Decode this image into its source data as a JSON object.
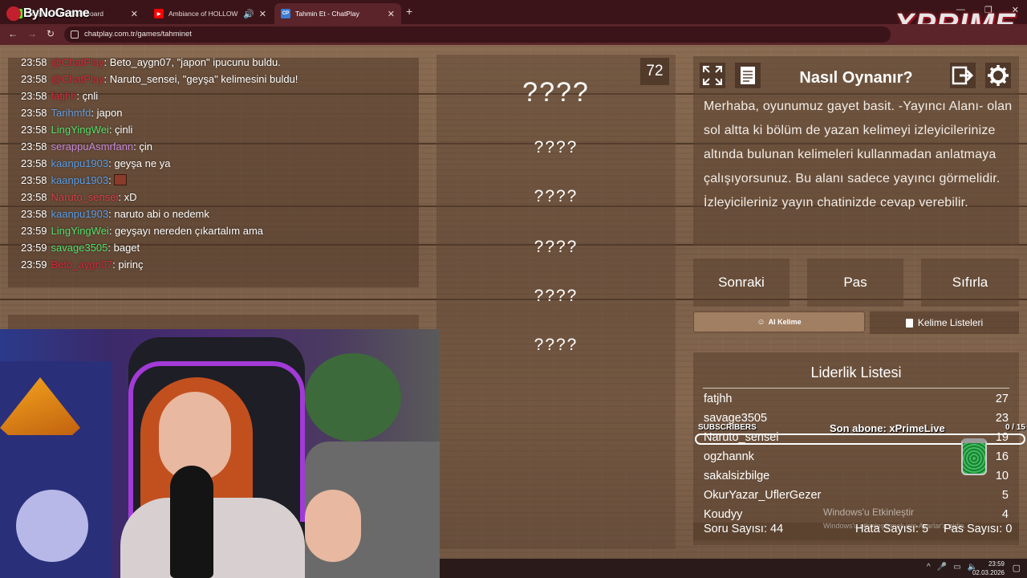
{
  "browser": {
    "tabs": [
      {
        "title": "Stream - Kick Dashboard",
        "icon": "kick-icon",
        "color": "#53fc18"
      },
      {
        "title": "Ambiance of HOLLOW KNIGHT",
        "icon": "youtube-icon",
        "color": "#ff0000"
      },
      {
        "title": "Tahmin Et - ChatPlay",
        "icon": "chatplay-icon",
        "color": "#3a7bd5"
      }
    ],
    "url": "chatplay.com.tr/games/tahminet"
  },
  "overlay": {
    "channel_logo": "ByNoGame",
    "brand": "XPRIME"
  },
  "chat": {
    "messages": [
      {
        "time": "23:58",
        "user": "@ChatPlay",
        "text": ": Beto_aygn07, \"japon\" ipucunu buldu.",
        "color": "#d42a3a"
      },
      {
        "time": "23:58",
        "user": "@ChatPlay",
        "text": ": Naruto_sensei, \"geyşa\" kelimesini buldu!",
        "color": "#d42a3a"
      },
      {
        "time": "23:58",
        "user": "fatjhh",
        "text": ": çnli",
        "color": "#d42a3a"
      },
      {
        "time": "23:58",
        "user": "Tarihmfd",
        "text": ": japon",
        "color": "#6a9edc"
      },
      {
        "time": "23:58",
        "user": "LingYingWei",
        "text": ": çinli",
        "color": "#55e06a"
      },
      {
        "time": "23:58",
        "user": "serappuAsmrfann",
        "text": ": çin",
        "color": "#c98ad8"
      },
      {
        "time": "23:58",
        "user": "kaanpu1903",
        "text": ": geyşa ne ya",
        "color": "#5a9ee8"
      },
      {
        "time": "23:58",
        "user": "kaanpu1903",
        "text": ": ",
        "color": "#5a9ee8",
        "emote": true
      },
      {
        "time": "23:58",
        "user": "Naruto_sensei",
        "text": ": xD",
        "color": "#d4404a"
      },
      {
        "time": "23:58",
        "user": "kaanpu1903",
        "text": ": naruto abi o nedemk",
        "color": "#5a9ee8"
      },
      {
        "time": "23:59",
        "user": "LingYingWei",
        "text": ": geyşayı nereden çıkartalım ama",
        "color": "#55e06a"
      },
      {
        "time": "23:59",
        "user": "savage3505",
        "text": ": baget",
        "color": "#55e06a"
      },
      {
        "time": "23:59",
        "user": "Beto_aygn07",
        "text": ": pirinç",
        "color": "#d42a3a"
      }
    ]
  },
  "game": {
    "timer": "72",
    "words": [
      "????",
      "????",
      "????",
      "????",
      "????",
      "????"
    ]
  },
  "howto": {
    "title": "Nasıl Oynanır?",
    "text": "Merhaba, oyunumuz gayet basit. -Yayıncı Alanı- olan sol altta ki bölüm de yazan kelimeyi izleyicilerinize altında bulunan kelimeleri kullanmadan anlatmaya çalışıyorsunuz. Bu alanı sadece yayıncı görmelidir. İzleyicileriniz yayın chatinizde cevap verebilir."
  },
  "buttons": {
    "next": "Sonraki",
    "pass": "Pas",
    "reset": "Sıfırla",
    "ai_word": "AI Kelime",
    "word_lists": "Kelime Listeleri"
  },
  "leaderboard": {
    "title": "Liderlik Listesi",
    "rows": [
      {
        "name": "fatjhh",
        "score": "27"
      },
      {
        "name": "savage3505",
        "score": "23"
      },
      {
        "name": "Naruto_sensei",
        "score": "19"
      },
      {
        "name": "ogzhannk",
        "score": "16"
      },
      {
        "name": "sakalsizbilge",
        "score": "10"
      },
      {
        "name": "OkurYazar_UflerGezer",
        "score": "5"
      },
      {
        "name": "Koudyy",
        "score": "4"
      }
    ],
    "question_count": "Soru Sayısı: 44",
    "error_count": "Hata Sayısı: 5",
    "pass_count": "Pas Sayısı: 0"
  },
  "sub_goal": {
    "label": "SUBSCRIBERS",
    "last_sub": "Son abone: xPrimeLive",
    "count": "0 / 15"
  },
  "windows": {
    "activate": "Windows'u Etkinleştir",
    "activate_hint": "Windows'u etkinleştirmek için Ayarlar'a gidin.",
    "time": "23:59",
    "date": "02.03.2026"
  }
}
